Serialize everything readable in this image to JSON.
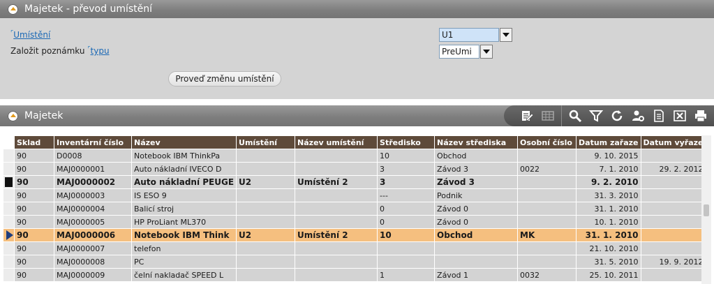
{
  "panel1": {
    "title": "Majetek - převod umístění",
    "umisteni_label": "Umístění",
    "umisteni_value": "U1",
    "note_prefix": "Založit poznámku ",
    "note_link": "typu",
    "type_value": "PreUmi",
    "apply_button": "Proveď změnu umístění"
  },
  "panel2": {
    "title": "Majetek",
    "toolbar": [
      "edit-icon",
      "table-icon",
      "search-icon",
      "filter-icon",
      "refresh-icon",
      "settings-user-icon",
      "document-icon",
      "excel-icon",
      "print-icon"
    ]
  },
  "grid": {
    "columns": [
      "Sklad",
      "Inventární číslo",
      "Název",
      "Umístění",
      "Název umístění",
      "Středisko",
      "Název střediska",
      "Osobní číslo",
      "Datum zařaze",
      "Datum vyřaze"
    ],
    "rows": [
      {
        "marker": "",
        "style": "",
        "cells": [
          "90",
          "D0008",
          "Notebook IBM ThinkPa",
          "",
          "",
          "10",
          "Obchod",
          "",
          "9. 10. 2015",
          ""
        ]
      },
      {
        "marker": "",
        "style": "",
        "cells": [
          "90",
          "MAJ0000001",
          "Auto nákladní IVECO D",
          "",
          "",
          "3",
          "Závod 3",
          "0022",
          "7. 1. 2010",
          "29. 2. 2012"
        ]
      },
      {
        "marker": "square",
        "style": "bold",
        "cells": [
          "90",
          "MAJ0000002",
          "Auto nákladní PEUGE",
          "U2",
          "Umístění 2",
          "3",
          "Závod 3",
          "",
          "9. 2. 2010",
          ""
        ]
      },
      {
        "marker": "",
        "style": "",
        "cells": [
          "90",
          "MAJ0000003",
          "IS ESO 9",
          "",
          "",
          "---",
          "Podnik",
          "",
          "31. 3. 2010",
          ""
        ]
      },
      {
        "marker": "",
        "style": "",
        "cells": [
          "90",
          "MAJ0000004",
          "Balicí stroj",
          "",
          "",
          "0",
          "Závod 0",
          "",
          "31. 1. 2010",
          ""
        ]
      },
      {
        "marker": "",
        "style": "",
        "cells": [
          "90",
          "MAJ0000005",
          "HP ProLiant ML370",
          "",
          "",
          "0",
          "Závod 0",
          "",
          "10. 1. 2010",
          ""
        ]
      },
      {
        "marker": "arrow",
        "style": "bold active",
        "cells": [
          "90",
          "MAJ0000006",
          "Notebook IBM Think",
          "U2",
          "Umístění 2",
          "10",
          "Obchod",
          "MK",
          "31. 1. 2010",
          ""
        ]
      },
      {
        "marker": "",
        "style": "",
        "cells": [
          "90",
          "MAJ0000007",
          "telefon",
          "",
          "",
          "",
          "",
          "",
          "21. 10. 2010",
          ""
        ]
      },
      {
        "marker": "",
        "style": "",
        "cells": [
          "90",
          "MAJ0000008",
          "PC",
          "",
          "",
          "",
          "",
          "",
          "31. 5. 2010",
          "19. 9. 2012"
        ]
      },
      {
        "marker": "",
        "style": "",
        "cells": [
          "90",
          "MAJ0000009",
          "čelní nakladač SPEED L",
          "",
          "",
          "1",
          "Závod 1",
          "0032",
          "25. 10. 2011",
          ""
        ]
      }
    ]
  },
  "colors": {
    "header_bg": "#7e7e7e",
    "grid_header_bg": "#5e4a3a",
    "active_row_bg": "#f5bf7f",
    "link": "#1a68b5"
  }
}
